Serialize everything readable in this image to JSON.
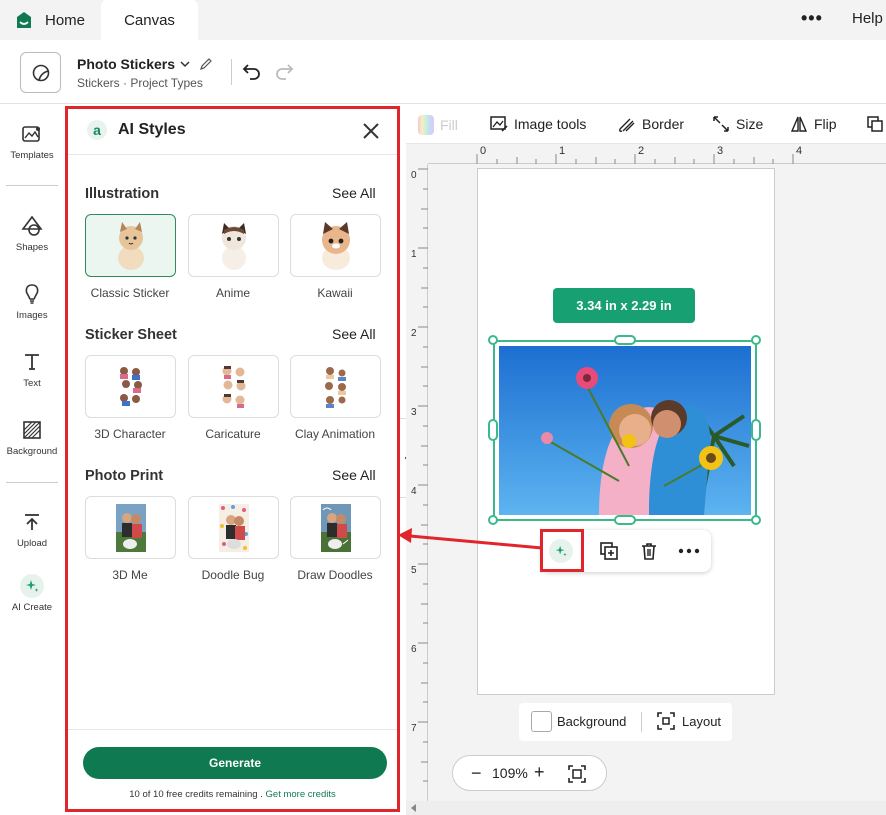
{
  "tabs": {
    "home": "Home",
    "canvas": "Canvas",
    "more": "•••",
    "help": "Help"
  },
  "project": {
    "title": "Photo Stickers",
    "breadcrumb": "Stickers  ·  Project Types"
  },
  "rail": {
    "templates": "Templates",
    "shapes": "Shapes",
    "images": "Images",
    "text": "Text",
    "background": "Background",
    "upload": "Upload",
    "ai_create": "AI Create"
  },
  "panel": {
    "title": "AI Styles",
    "sections": [
      {
        "title": "Illustration",
        "see_all": "See All",
        "items": [
          "Classic Sticker",
          "Anime",
          "Kawaii"
        ]
      },
      {
        "title": "Sticker Sheet",
        "see_all": "See All",
        "items": [
          "3D Character",
          "Caricature",
          "Clay Animation"
        ]
      },
      {
        "title": "Photo Print",
        "see_all": "See All",
        "items": [
          "3D Me",
          "Doodle Bug",
          "Draw Doodles"
        ]
      }
    ],
    "generate": "Generate",
    "credits": "10 of 10 free credits remaining . ",
    "credits_link": "Get more credits"
  },
  "toolbar": {
    "fill": "Fill",
    "image_tools": "Image tools",
    "border": "Border",
    "size": "Size",
    "flip": "Flip"
  },
  "ruler_top": [
    "0",
    "1",
    "2",
    "3",
    "4"
  ],
  "ruler_left": [
    "0",
    "1",
    "2",
    "3",
    "4",
    "5",
    "6",
    "7"
  ],
  "selection": {
    "dimensions": "3.34  in x 2.29  in"
  },
  "bottom": {
    "background": "Background",
    "layout": "Layout",
    "zoom": "109%"
  },
  "colors": {
    "brand": "#0f7a52",
    "highlight": "#e0252b",
    "badge": "#17a072"
  }
}
